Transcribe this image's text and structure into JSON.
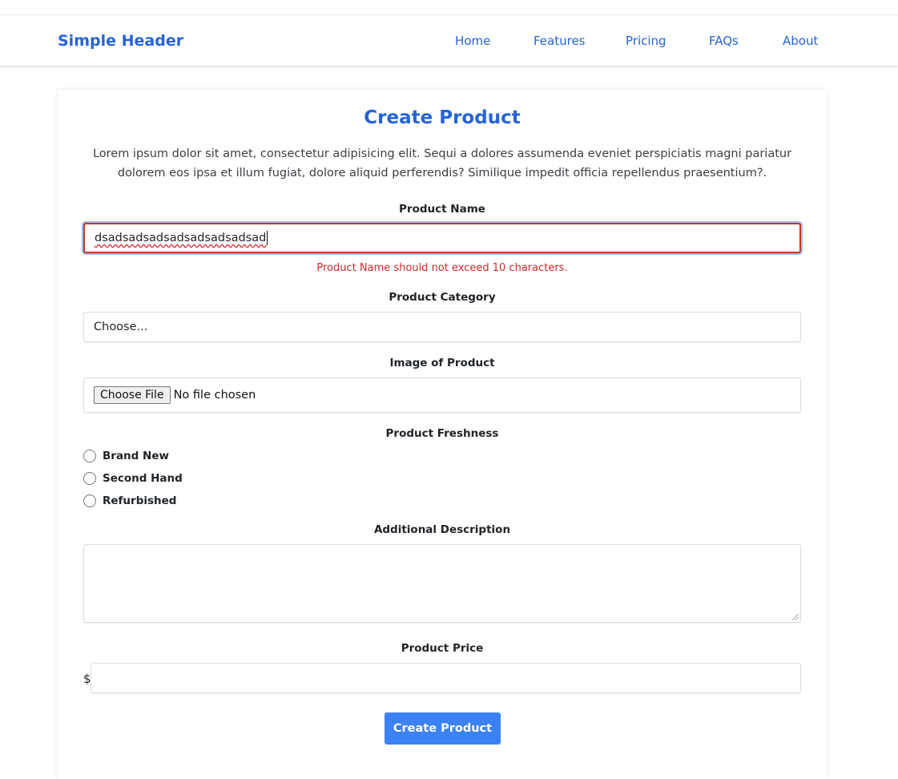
{
  "header": {
    "brand": "Simple Header",
    "nav": [
      "Home",
      "Features",
      "Pricing",
      "FAQs",
      "About"
    ]
  },
  "form": {
    "title": "Create Product",
    "intro": "Lorem ipsum dolor sit amet, consectetur adipisicing elit. Sequi a dolores assumenda eveniet perspiciatis magni pariatur dolorem eos ipsa et illum fugiat, dolore aliquid perferendis? Similique impedit officia repellendus praesentium?.",
    "product_name": {
      "label": "Product Name",
      "value": "dsadsadsadsadsadsadsadsad",
      "error": "Product Name should not exceed 10 characters."
    },
    "category": {
      "label": "Product Category",
      "selected": "Choose..."
    },
    "image": {
      "label": "Image of Product",
      "button": "Choose File",
      "status": "No file chosen"
    },
    "freshness": {
      "label": "Product Freshness",
      "options": [
        "Brand New",
        "Second Hand",
        "Refurbished"
      ]
    },
    "description": {
      "label": "Additional Description",
      "value": ""
    },
    "price": {
      "label": "Product Price",
      "currency": "$",
      "value": ""
    },
    "submit_label": "Create Product"
  },
  "colors": {
    "primary": "#2563d8",
    "button": "#3b82f6",
    "error": "#c92a2a"
  }
}
